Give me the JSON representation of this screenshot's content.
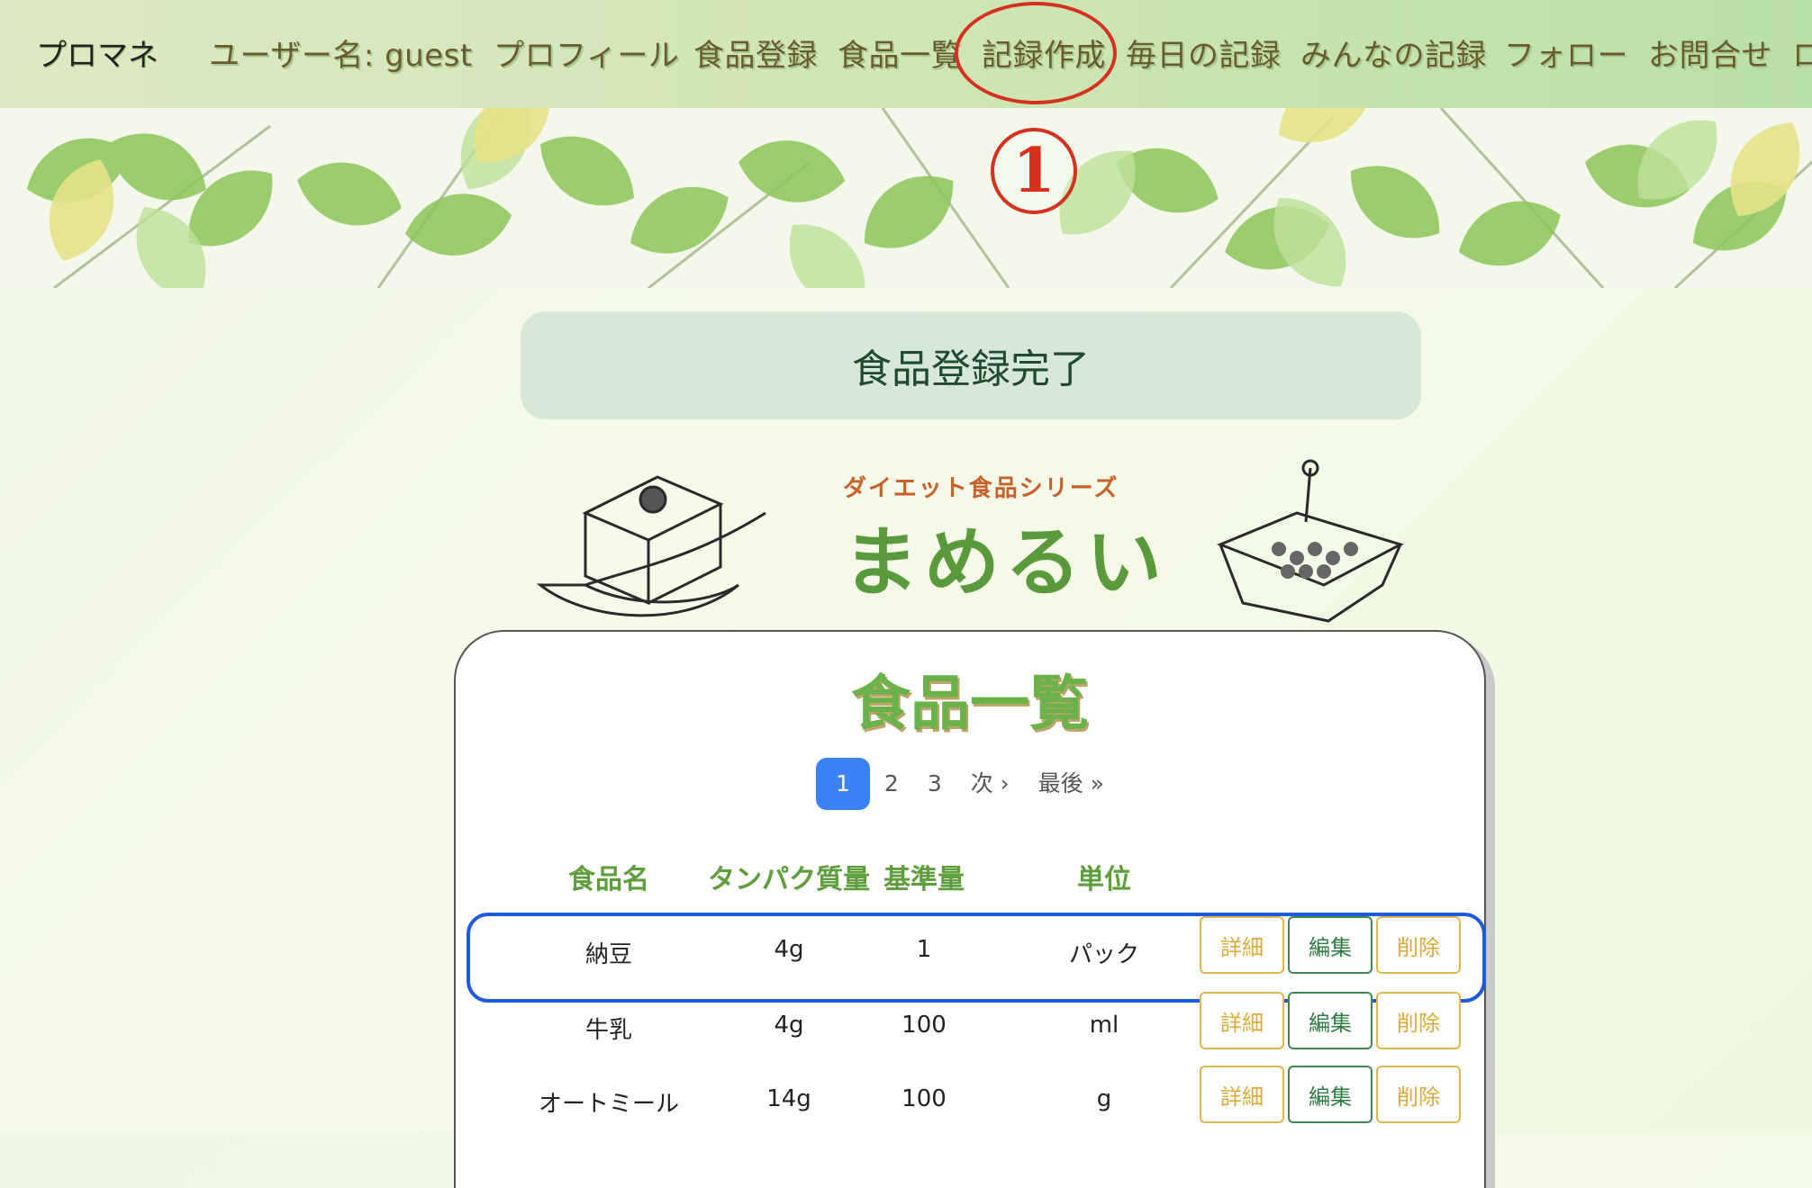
{
  "nav": {
    "brand": "プロマネ",
    "user_label": "ユーザー名: guest",
    "items": [
      {
        "label": "プロフィール"
      },
      {
        "label": "食品登録"
      },
      {
        "label": "食品一覧"
      },
      {
        "label": "記録作成"
      },
      {
        "label": "毎日の記録"
      },
      {
        "label": "みんなの記録"
      },
      {
        "label": "フォロー"
      },
      {
        "label": "お問合せ"
      },
      {
        "label": "ロ"
      }
    ]
  },
  "annotation": {
    "step_number": "1",
    "color": "#d6301f",
    "highlight_color": "#1e5ae0"
  },
  "flash": {
    "message": "食品登録完了"
  },
  "logo": {
    "subtitle": "ダイエット食品シリーズ",
    "title": "まめるい"
  },
  "card": {
    "title": "食品一覧",
    "pagination": {
      "pages": [
        "1",
        "2",
        "3"
      ],
      "active": "1",
      "next": "次 ›",
      "last": "最後 »"
    },
    "columns": [
      "食品名",
      "タンパク質量",
      "基準量",
      "単位"
    ],
    "rows": [
      {
        "name": "納豆",
        "protein": "4g",
        "base": "1",
        "unit": "パック"
      },
      {
        "name": "牛乳",
        "protein": "4g",
        "base": "100",
        "unit": "ml"
      },
      {
        "name": "オートミール",
        "protein": "14g",
        "base": "100",
        "unit": "g"
      }
    ],
    "actions": {
      "detail": "詳細",
      "edit": "編集",
      "delete": "削除"
    }
  }
}
